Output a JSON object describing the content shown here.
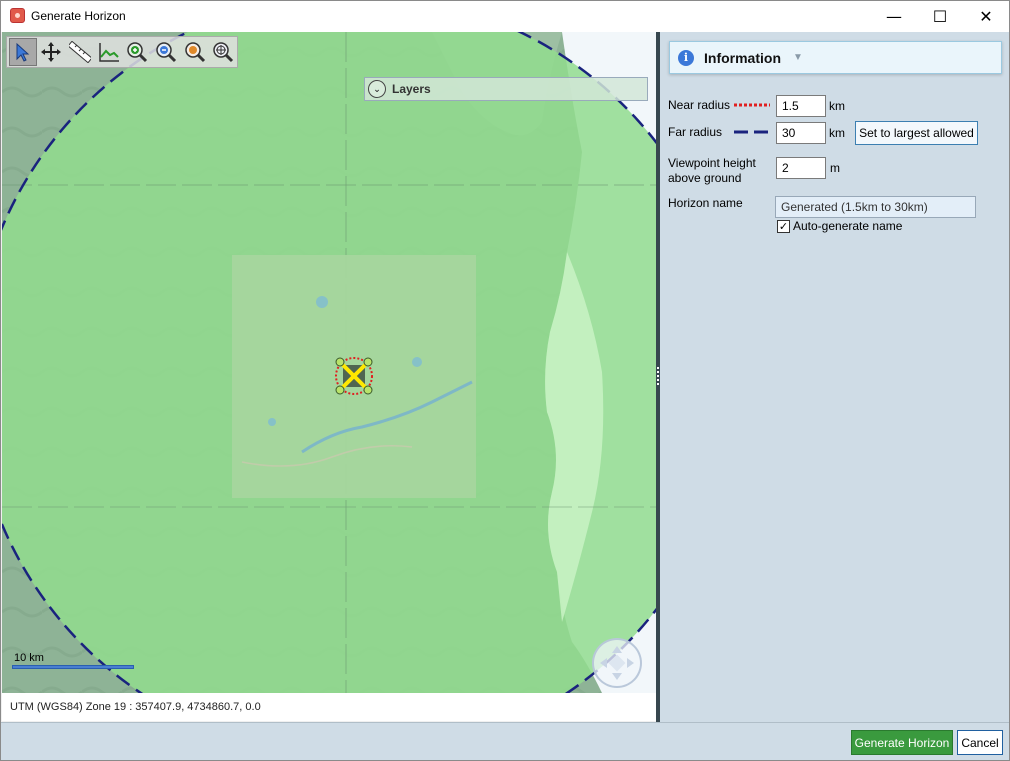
{
  "window": {
    "title": "Generate Horizon",
    "minimize_glyph": "—",
    "maximize_glyph": "☐",
    "close_glyph": "✕"
  },
  "map": {
    "toolbar": [
      {
        "name": "select-tool",
        "icon": "pointer-icon",
        "active": true
      },
      {
        "name": "pan-tool",
        "icon": "move-arrows-icon",
        "active": false
      },
      {
        "name": "measure-tool",
        "icon": "ruler-icon",
        "active": false
      },
      {
        "name": "profile-tool",
        "icon": "elevation-profile-icon",
        "active": false
      },
      {
        "name": "zoom-in-tool",
        "icon": "zoom-in-icon",
        "active": false
      },
      {
        "name": "zoom-out-tool",
        "icon": "zoom-out-icon",
        "active": false
      },
      {
        "name": "zoom-extent-tool",
        "icon": "zoom-extent-icon",
        "active": false
      },
      {
        "name": "zoom-fit-tool",
        "icon": "zoom-fit-icon",
        "active": false
      }
    ],
    "layers_label": "Layers",
    "scale_label": "10 km"
  },
  "status": {
    "coords": "UTM (WGS84) Zone 19   : 357407.9, 4734860.7, 0.0"
  },
  "panel": {
    "info_title": "Information",
    "near_radius_label": "Near radius",
    "near_radius_value": "1.5",
    "near_radius_unit": "km",
    "far_radius_label": "Far radius",
    "far_radius_value": "30",
    "far_radius_unit": "km",
    "set_largest_label": "Set to largest allowed",
    "viewpoint_label_1": "Viewpoint height",
    "viewpoint_label_2": "above ground",
    "viewpoint_value": "2",
    "viewpoint_unit": "m",
    "horizon_name_label": "Horizon name",
    "horizon_name_value": "Generated (1.5km to 30km)",
    "auto_generate_label": "Auto-generate name",
    "auto_generate_checked": true
  },
  "buttons": {
    "generate": "Generate Horizon",
    "cancel": "Cancel"
  },
  "colors": {
    "accent_green": "#3a9a3e",
    "panel_bg": "#cfdce6",
    "near_radius_line": "#e02020",
    "far_radius_line": "#1a237e"
  }
}
